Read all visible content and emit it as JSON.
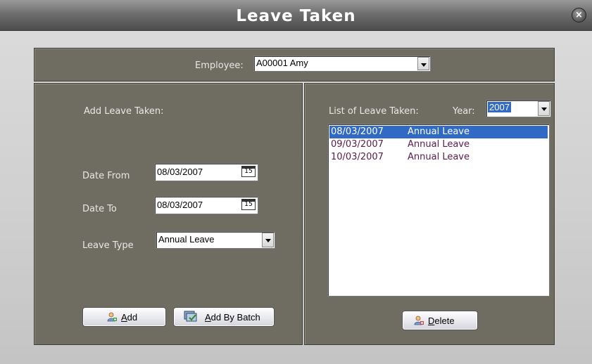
{
  "window": {
    "title": "Leave Taken",
    "close_label": "×"
  },
  "employee": {
    "label": "Employee:",
    "value": "A00001  Amy"
  },
  "add_panel": {
    "heading": "Add Leave Taken:",
    "date_from_label": "Date From",
    "date_from_value": "08/03/2007",
    "date_to_label": "Date To",
    "date_to_value": "08/03/2007",
    "leave_type_label": "Leave Type",
    "leave_type_value": "Annual Leave",
    "calendar_glyph": "15",
    "add_button": {
      "accel": "A",
      "rest": "dd"
    },
    "add_batch_button": {
      "accel": "A",
      "rest": "dd By Batch"
    }
  },
  "list_panel": {
    "heading": "List of Leave Taken:",
    "year_label": "Year:",
    "year_value": "2007",
    "rows": [
      {
        "date": "08/03/2007",
        "type": "Annual Leave",
        "selected": true
      },
      {
        "date": "09/03/2007",
        "type": "Annual Leave",
        "selected": false
      },
      {
        "date": "10/03/2007",
        "type": "Annual Leave",
        "selected": false
      }
    ],
    "delete_button": {
      "accel": "D",
      "rest": "elete"
    }
  },
  "colors": {
    "panel": "#6f6d62",
    "selection": "#316ac5",
    "row_text": "#5b1a4a",
    "titlebar": "#5a5a5a"
  },
  "icons": [
    "close-icon",
    "dropdown-arrow-icon",
    "calendar-icon",
    "add-user-icon",
    "batch-icon",
    "delete-user-icon"
  ]
}
